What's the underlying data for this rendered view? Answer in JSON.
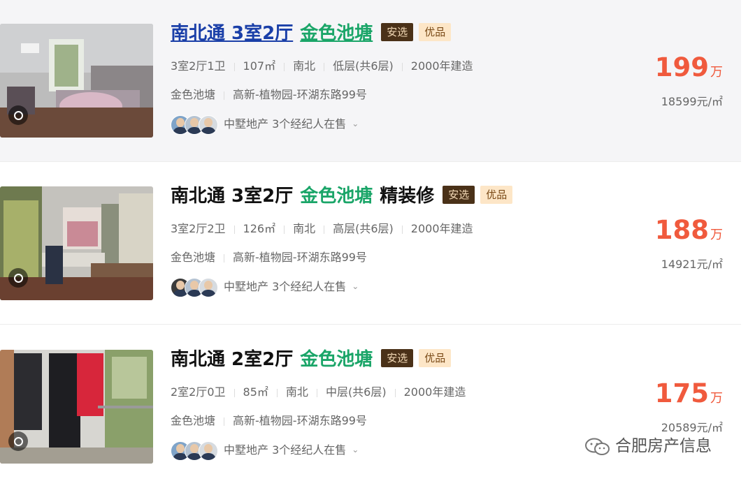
{
  "listings": [
    {
      "title_main": "南北通 3室2厅",
      "title_community": "金色池塘",
      "title_extra": "",
      "tags": [
        "安选",
        "优品"
      ],
      "layout": "3室2厅1卫",
      "area": "107㎡",
      "orientation": "南北",
      "floor": "低层(共6层)",
      "built": "2000年建造",
      "community": "金色池塘",
      "location": "高新-植物园-环湖东路99号",
      "agency": "中墅地产",
      "agents_count": "3个经纪人在售",
      "price": "199",
      "price_unit": "万",
      "unit_price": "18599元/㎡"
    },
    {
      "title_main": "南北通 3室2厅",
      "title_community": "金色池塘",
      "title_extra": "精装修",
      "tags": [
        "安选",
        "优品"
      ],
      "layout": "3室2厅2卫",
      "area": "126㎡",
      "orientation": "南北",
      "floor": "高层(共6层)",
      "built": "2000年建造",
      "community": "金色池塘",
      "location": "高新-植物园-环湖东路99号",
      "agency": "中墅地产",
      "agents_count": "3个经纪人在售",
      "price": "188",
      "price_unit": "万",
      "unit_price": "14921元/㎡"
    },
    {
      "title_main": "南北通 2室2厅",
      "title_community": "金色池塘",
      "title_extra": "",
      "tags": [
        "安选",
        "优品"
      ],
      "layout": "2室2厅0卫",
      "area": "85㎡",
      "orientation": "南北",
      "floor": "中层(共6层)",
      "built": "2000年建造",
      "community": "金色池塘",
      "location": "高新-植物园-环湖东路99号",
      "agency": "中墅地产",
      "agents_count": "3个经纪人在售",
      "price": "175",
      "price_unit": "万",
      "unit_price": "20589元/㎡"
    }
  ],
  "watermark": {
    "text": "合肥房产信息",
    "icon": "wechat-icon"
  },
  "colors": {
    "price": "#f05a3d",
    "community": "#1aa568",
    "link": "#1a3fa8",
    "anxuan_bg": "#4a3118",
    "youpin_bg": "#fde6c7"
  }
}
